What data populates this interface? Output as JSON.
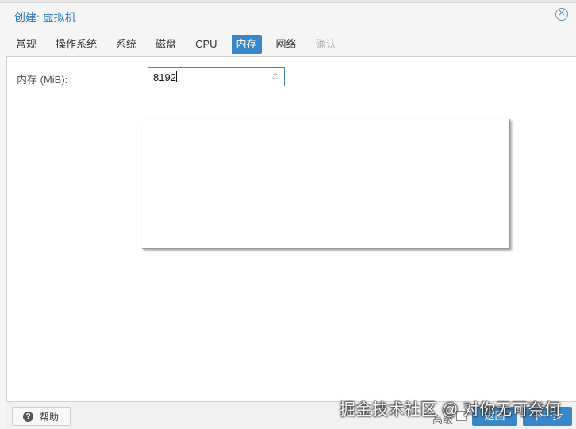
{
  "dialog": {
    "title": "创建: 虚拟机",
    "close_icon": "close-circle-icon"
  },
  "tabs": [
    {
      "label": "常规",
      "state": "normal"
    },
    {
      "label": "操作系统",
      "state": "normal"
    },
    {
      "label": "系统",
      "state": "normal"
    },
    {
      "label": "磁盘",
      "state": "normal"
    },
    {
      "label": "CPU",
      "state": "normal"
    },
    {
      "label": "内存",
      "state": "active"
    },
    {
      "label": "网络",
      "state": "normal"
    },
    {
      "label": "确认",
      "state": "disabled"
    }
  ],
  "memory": {
    "label": "内存 (MiB):",
    "value": "8192"
  },
  "footer": {
    "help_label": "帮助",
    "help_icon": "question-circle-icon",
    "advanced_label": "高级",
    "back_label": "返回",
    "next_label": "下一步"
  },
  "watermark": "掘金技术社区 @ 对你无可奈何",
  "colors": {
    "accent": "#3a87c8",
    "title": "#2f76b8",
    "disabled": "#b5b5b5"
  }
}
